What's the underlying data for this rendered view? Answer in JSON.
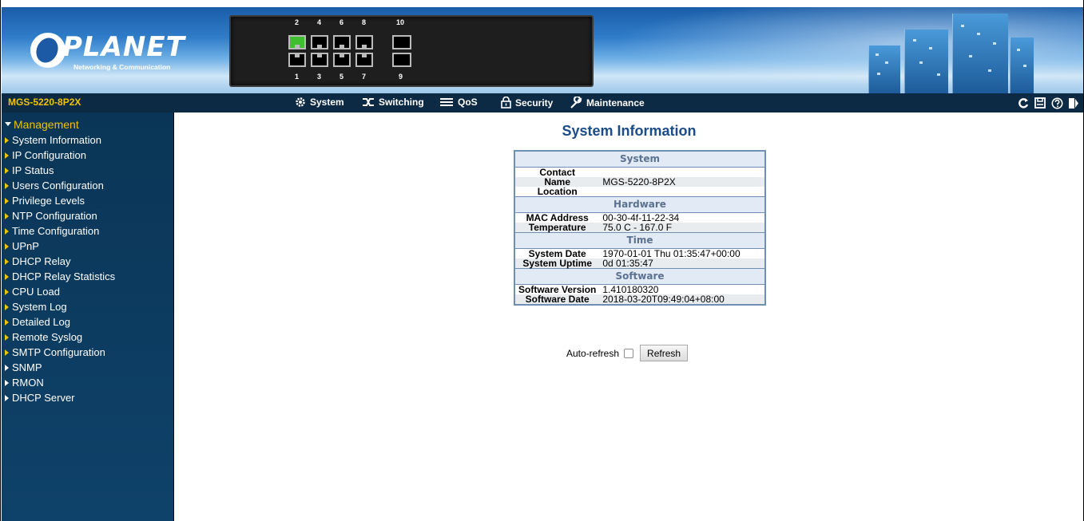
{
  "banner": {
    "logo_text": "PLANET",
    "logo_sub": "Networking & Communication",
    "ports_top": [
      "2",
      "4",
      "6",
      "8",
      "10"
    ],
    "ports_bottom": [
      "1",
      "3",
      "5",
      "7",
      "9"
    ],
    "active_port": "2"
  },
  "navbar": {
    "model": "MGS-5220-8P2X",
    "items": [
      "System",
      "Switching",
      "QoS",
      "Security",
      "Maintenance"
    ],
    "tools": [
      "refresh-icon",
      "save-icon",
      "help-icon",
      "logout-icon"
    ]
  },
  "sidebar": {
    "group": "Management",
    "items": [
      "System Information",
      "IP Configuration",
      "IP Status",
      "Users Configuration",
      "Privilege Levels",
      "NTP Configuration",
      "Time Configuration",
      "UPnP",
      "DHCP Relay",
      "DHCP Relay Statistics",
      "CPU Load",
      "System Log",
      "Detailed Log",
      "Remote Syslog",
      "SMTP Configuration"
    ],
    "collapsed": [
      "SNMP",
      "RMON",
      "DHCP Server"
    ]
  },
  "main": {
    "title": "System Information",
    "sections": {
      "system": "System",
      "hardware": "Hardware",
      "time": "Time",
      "software": "Software"
    },
    "rows": {
      "contact_k": "Contact",
      "contact_v": "",
      "name_k": "Name",
      "name_v": "MGS-5220-8P2X",
      "location_k": "Location",
      "location_v": "",
      "mac_k": "MAC Address",
      "mac_v": "00-30-4f-11-22-34",
      "temp_k": "Temperature",
      "temp_v": "75.0 C - 167.0 F",
      "sysdate_k": "System Date",
      "sysdate_v": "1970-01-01 Thu 01:35:47+00:00",
      "uptime_k": "System Uptime",
      "uptime_v": "0d 01:35:47",
      "swver_k": "Software Version",
      "swver_v": "1.410180320",
      "swdate_k": "Software Date",
      "swdate_v": "2018-03-20T09:49:04+08:00"
    },
    "auto_refresh_label": "Auto-refresh",
    "refresh_button": "Refresh"
  }
}
